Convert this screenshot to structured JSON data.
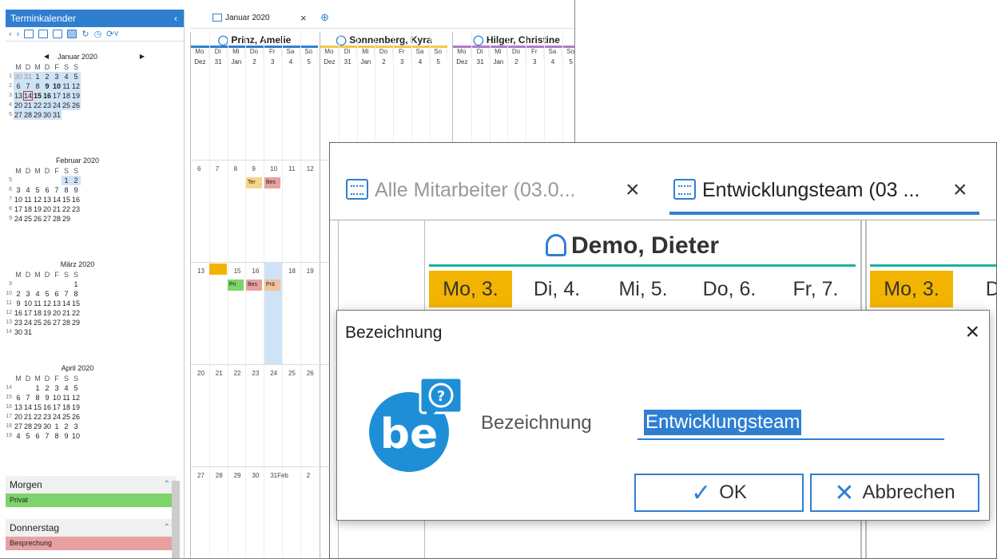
{
  "sidebar": {
    "title": "Terminkalender",
    "months": [
      {
        "name": "Januar 2020"
      },
      {
        "name": "Februar 2020"
      },
      {
        "name": "März 2020"
      },
      {
        "name": "April 2020"
      }
    ],
    "dow": [
      "M",
      "D",
      "M",
      "D",
      "F",
      "S",
      "S"
    ],
    "agenda": [
      {
        "heading": "Morgen",
        "item": "Privat",
        "color": "#7ed36a"
      },
      {
        "heading": "Donnerstag",
        "item": "Besprechung",
        "color": "#e8a0a0"
      }
    ]
  },
  "calendar_tab": {
    "label": "Januar 2020"
  },
  "people": [
    {
      "name": "Prinz, Amelie",
      "color": "#2f7fd1"
    },
    {
      "name": "Sonnenberg, Kyra",
      "color": "#f2c94c"
    },
    {
      "name": "Hilger, Christine",
      "color": "#b07cc6"
    }
  ],
  "week_dow": [
    "Mo",
    "Di",
    "Mi",
    "Do",
    "Fr",
    "Sa",
    "So"
  ],
  "week_first_nums": [
    "Dez",
    "31",
    "Jan",
    "2",
    "3",
    "4",
    "5"
  ],
  "events": [
    {
      "label": "Ter",
      "color": "#f6d58b"
    },
    {
      "label": "Bes",
      "color": "#e8a0a0"
    },
    {
      "label": "Pri",
      "color": "#7ed36a"
    },
    {
      "label": "Bes",
      "color": "#e8a0a0"
    },
    {
      "label": "Prä",
      "color": "#f4c09a"
    }
  ],
  "overlay": {
    "tab1": "Alle Mitarbeiter (03.0...",
    "tab2": "Entwicklungsteam (03 ...",
    "person": "Demo, Dieter",
    "days": [
      "Mo, 3.",
      "Di, 4.",
      "Mi, 5.",
      "Do, 6.",
      "Fr, 7."
    ],
    "days2": [
      "Mo, 3.",
      "Di,"
    ]
  },
  "dialog": {
    "title": "Bezeichnung",
    "field_label": "Bezeichnung",
    "field_value": "Entwicklungsteam",
    "ok": "OK",
    "cancel": "Abbrechen"
  },
  "colors": {
    "accent": "#2f7fd1",
    "highlight": "#f2b400",
    "teal": "#1cb0a0"
  }
}
